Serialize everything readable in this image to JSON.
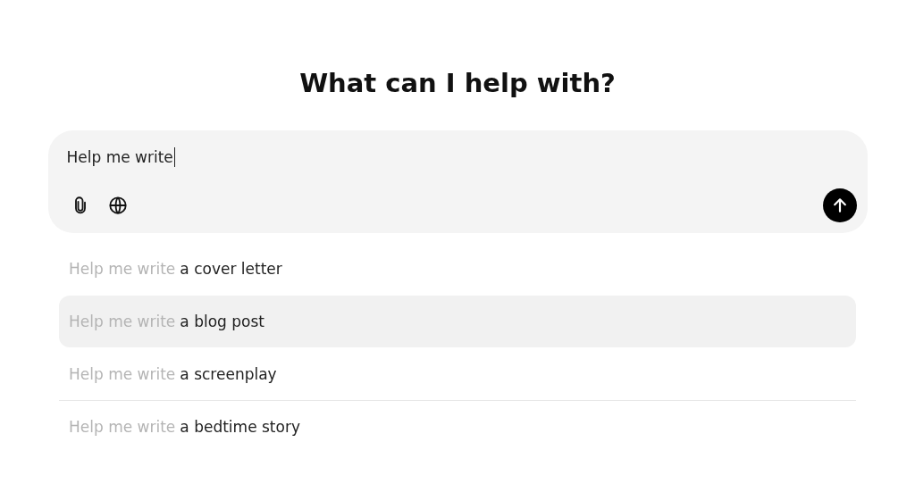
{
  "heading": "What can I help with?",
  "composer": {
    "value": "Help me write",
    "focused": true
  },
  "suggestions": [
    {
      "prefix": "Help me write",
      "completion": "a cover letter",
      "selected": false
    },
    {
      "prefix": "Help me write",
      "completion": "a blog post",
      "selected": true
    },
    {
      "prefix": "Help me write",
      "completion": "a screenplay",
      "selected": false
    },
    {
      "prefix": "Help me write",
      "completion": "a bedtime story",
      "selected": false
    }
  ]
}
